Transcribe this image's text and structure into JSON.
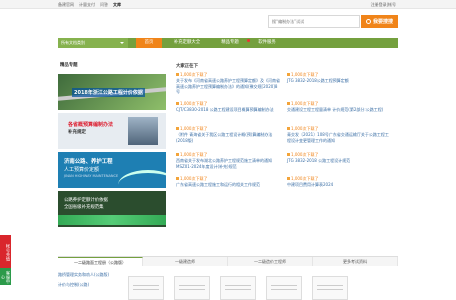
{
  "topbar": {
    "links": [
      "备建官网",
      "计量支付",
      "问答",
      "文库"
    ],
    "active_index": 3,
    "right_text": "注册登录|帐号"
  },
  "search": {
    "placeholder": "搜“编制办法”试试",
    "button_label": "我要搜搜"
  },
  "nav": {
    "category_label": "所有文档类别",
    "items": [
      "首页",
      "补充定额大全",
      "精品专题",
      "软件服务"
    ],
    "active_index": 0
  },
  "left_panel": {
    "title": "精品专题",
    "banners": [
      {
        "line1": "2018年浙江公路工程计价依据"
      },
      {
        "line1": "各省概预算编制办法",
        "line2": "补充规定"
      },
      {
        "line1": "济南公路、养护工程",
        "line2": "人工预算价定额",
        "line3": "JINAN HIGHWAY MAINTENANCE"
      },
      {
        "line1": "公路养护定额计价依据",
        "line2": "全国省级补充规范集"
      }
    ]
  },
  "recommend": {
    "title": "大家正在下",
    "download_label": "1,000次下载了",
    "items": [
      {
        "title": "关于发布《河南省高速公路养护工程预算定额》及《河南省高速公路养护工程预算编制办法》的通知(豫交规[2020]8号"
      },
      {
        "title": "JTG 3832-2018公路工程预算定额"
      },
      {
        "title": "CJT/C3830-2018 公路工程建设项目概算预算编制办法"
      },
      {
        "title": "交通建设工程工程量清单 计价规范(第2部分:公路工程)"
      },
      {
        "title": "（附件 青海省关于我区公路工程设计概(预)算编制办法(2018版)"
      },
      {
        "title": "青交发〔2021〕108号广东省交通运输厅关于公路工程工程设计变更管理工作的通知"
      },
      {
        "title": "西南省关于发布湖北公路养护工程规范施工清单的通知MSZ01-2024年度设计(补充)规范"
      },
      {
        "title": "JTG 3832-2018 公路工程设计规范"
      },
      {
        "title": "广东省高速公路工程施工和运行的相关工作规范"
      },
      {
        "title": "中建项目费用计算表2024"
      }
    ]
  },
  "bottom": {
    "tabs": [
      "一二级路面工程册（公路版）",
      "一级建造师",
      "一二级造价工程师",
      "更多考试资料"
    ],
    "active_index": 0,
    "side_items": [
      "路桥管理实务和劝人(公路版)",
      "计价与控制(公路)"
    ]
  },
  "side_float": {
    "top_label": "帐号充值",
    "bottom_label": "客服中心"
  },
  "colors": {
    "nav_green": "#74a03e",
    "accent_orange": "#f08419",
    "link_blue": "#3a6ea5"
  }
}
